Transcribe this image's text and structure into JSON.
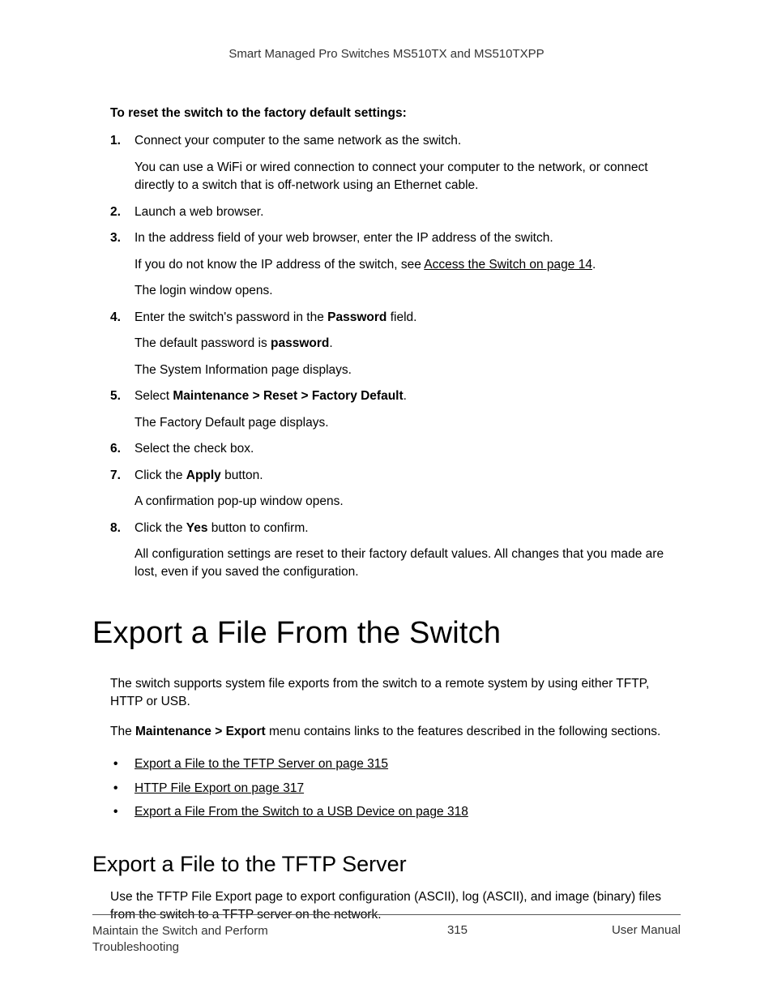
{
  "header": {
    "title": "Smart Managed Pro Switches MS510TX and MS510TXPP"
  },
  "intro": {
    "heading": "To reset the switch to the factory default settings:"
  },
  "steps": {
    "s1": {
      "main": "Connect your computer to the same network as the switch.",
      "p1": "You can use a WiFi or wired connection to connect your computer to the network, or connect directly to a switch that is off-network using an Ethernet cable."
    },
    "s2": {
      "main": "Launch a web browser."
    },
    "s3": {
      "main": "In the address field of your web browser, enter the IP address of the switch.",
      "p1_a": "If you do not know the IP address of the switch, see ",
      "p1_link": "Access the Switch on page 14",
      "p1_b": ".",
      "p2": "The login window opens."
    },
    "s4": {
      "main_a": "Enter the switch's password in the ",
      "main_bold": "Password",
      "main_b": " field.",
      "p1_a": "The default password is ",
      "p1_bold": "password",
      "p1_b": ".",
      "p2": "The System Information page displays."
    },
    "s5": {
      "main_a": "Select ",
      "main_bold": "Maintenance > Reset > Factory Default",
      "main_b": ".",
      "p1": "The Factory Default page displays."
    },
    "s6": {
      "main": "Select the check box."
    },
    "s7": {
      "main_a": "Click the ",
      "main_bold": "Apply",
      "main_b": " button.",
      "p1": "A confirmation pop-up window opens."
    },
    "s8": {
      "main_a": "Click the ",
      "main_bold": "Yes",
      "main_b": " button to confirm.",
      "p1": "All configuration settings are reset to their factory default values. All changes that you made are lost, even if you saved the configuration."
    }
  },
  "section": {
    "title": "Export a File From the Switch",
    "p1": "The switch supports system file exports from the switch to a remote system by using either TFTP, HTTP or USB.",
    "p2_a": "The ",
    "p2_bold": "Maintenance > Export",
    "p2_b": " menu contains links to the features described in the following sections."
  },
  "bullets": {
    "b1": "Export a File to the TFTP Server on page 315",
    "b2": "HTTP File Export on page 317",
    "b3": "Export a File From the Switch to a USB Device on page 318"
  },
  "subsection": {
    "title": "Export a File to the TFTP Server",
    "p1": "Use the TFTP File Export page to export configuration (ASCII), log (ASCII), and image (binary) files from the switch to a TFTP server on the network."
  },
  "footer": {
    "left": "Maintain the Switch and Perform Troubleshooting",
    "center": "315",
    "right": "User Manual"
  }
}
